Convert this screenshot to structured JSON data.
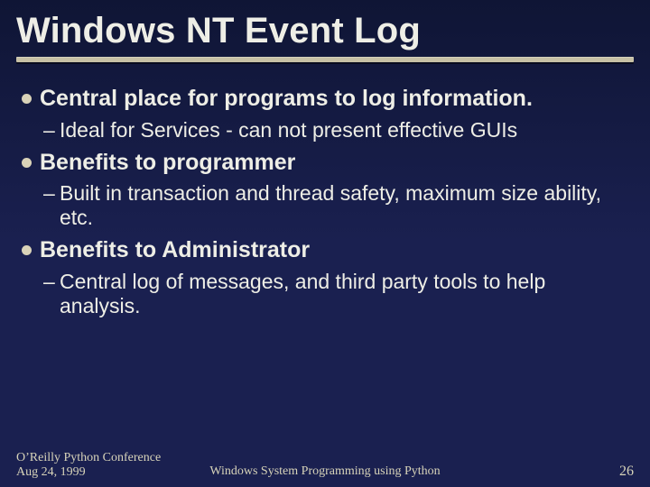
{
  "title": "Windows NT Event Log",
  "bullets": [
    {
      "text": "Central place for programs to log information.",
      "sub": [
        "Ideal for Services - can not present effective GUIs"
      ]
    },
    {
      "text": "Benefits to programmer",
      "sub": [
        "Built in transaction and thread safety, maximum size ability, etc."
      ]
    },
    {
      "text": "Benefits to Administrator",
      "sub": [
        "Central log of messages, and third party tools to help analysis."
      ]
    }
  ],
  "footer": {
    "left_line1": "O’Reilly Python Conference",
    "left_line2": "Aug 24, 1999",
    "center": "Windows System Programming using Python",
    "page": "26"
  }
}
